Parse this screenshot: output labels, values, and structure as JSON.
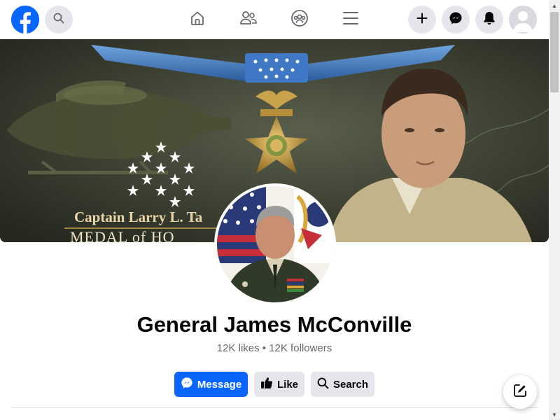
{
  "topbar": {
    "logo_icon": "facebook-logo-icon",
    "search_icon": "search-icon",
    "nav_items": [
      {
        "icon": "home-icon"
      },
      {
        "icon": "friends-icon"
      },
      {
        "icon": "groups-icon"
      },
      {
        "icon": "menu-icon"
      }
    ],
    "actions": [
      {
        "icon": "plus-icon"
      },
      {
        "icon": "messenger-icon"
      },
      {
        "icon": "bell-icon"
      },
      {
        "icon": "profile-avatar-icon"
      }
    ]
  },
  "cover": {
    "caption_line1": "Captain Larry L. Ta",
    "caption_line2": "MEDAL of HO"
  },
  "page": {
    "name": "General James McConville",
    "stats": "12K likes • 12K followers"
  },
  "actions": {
    "message_label": "Message",
    "like_label": "Like",
    "search_label": "Search"
  },
  "colors": {
    "brand": "#0866ff",
    "button_gray": "#e4e6eb",
    "text_primary": "#050505",
    "text_secondary": "#65676b"
  }
}
